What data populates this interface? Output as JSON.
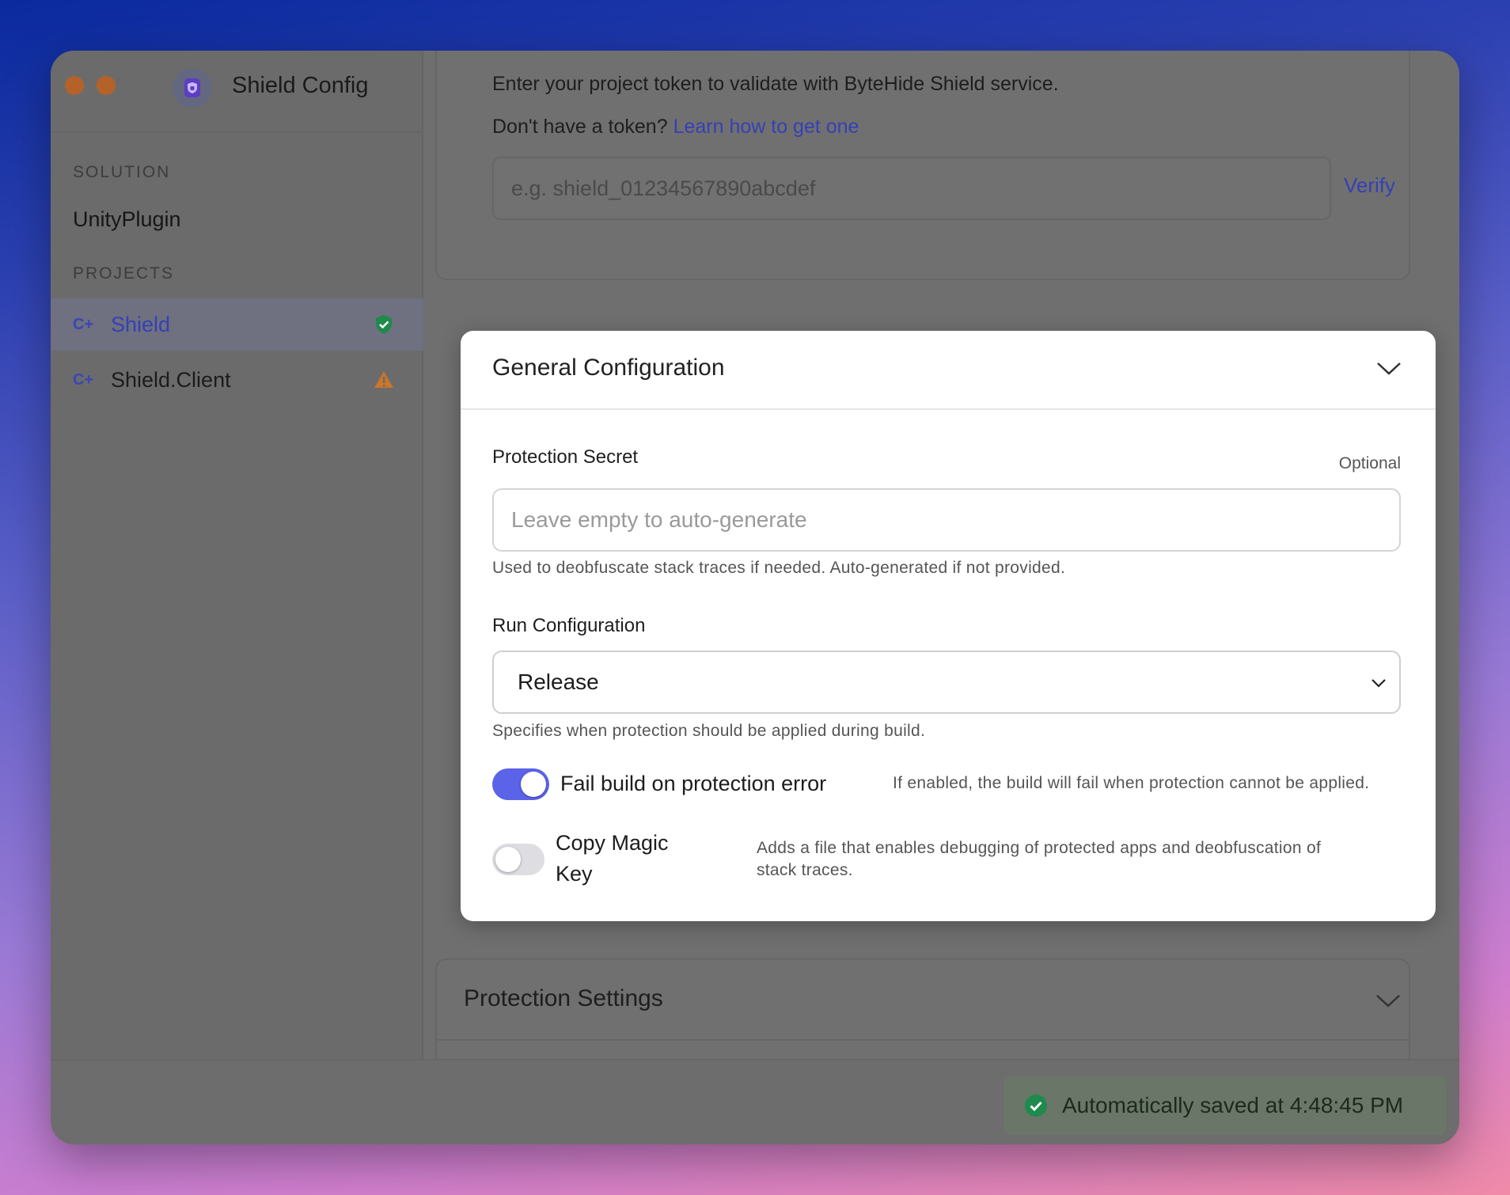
{
  "window": {
    "title": "Shield Config"
  },
  "sidebar": {
    "solution_label": "SOLUTION",
    "solution_name": "UnityPlugin",
    "projects_label": "PROJECTS",
    "projects": [
      {
        "icon": "csharp-icon",
        "name": "Shield",
        "status": "verified",
        "active": true
      },
      {
        "icon": "csharp-icon",
        "name": "Shield.Client",
        "status": "warning",
        "active": false
      }
    ]
  },
  "token": {
    "description": "Enter your project token to validate with ByteHide Shield service.",
    "help_prefix": "Don't have a token?",
    "help_link": "Learn how to get one",
    "placeholder": "e.g. shield_01234567890abcdef",
    "verify_label": "Verify"
  },
  "general": {
    "title": "General Configuration",
    "secret_label": "Protection Secret",
    "secret_optional": "Optional",
    "secret_placeholder": "Leave empty to auto-generate",
    "secret_hint": "Used to deobfuscate stack traces if needed. Auto-generated if not provided.",
    "run_label": "Run Configuration",
    "run_value": "Release",
    "run_hint": "Specifies when protection should be applied during build.",
    "fail_build": {
      "label": "Fail build on protection error",
      "description": "If enabled, the build will fail when protection cannot be applied.",
      "enabled": true
    },
    "magic_key": {
      "label_line1": "Copy Magic",
      "label_line2": "Key",
      "description_line1": "Adds a file that enables debugging of protected apps and deobfuscation of",
      "description_line2": "stack traces.",
      "enabled": false
    }
  },
  "protection_settings": {
    "title": "Protection Settings"
  },
  "footer": {
    "save_status": "Automatically saved at 4:48:45 PM"
  },
  "colors": {
    "accent": "#5b63e8",
    "link": "#3540b5",
    "verified": "#1e8a4c",
    "warning": "#c9752a"
  }
}
